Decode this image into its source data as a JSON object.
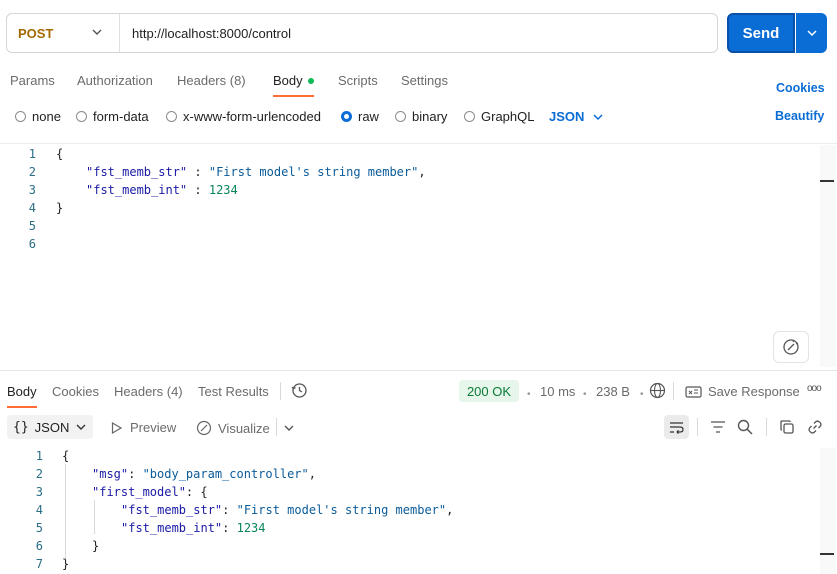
{
  "request": {
    "method": "POST",
    "url": "http://localhost:8000/control",
    "send_label": "Send"
  },
  "request_tabs": [
    {
      "label": "Params"
    },
    {
      "label": "Authorization"
    },
    {
      "label": "Headers (8)"
    },
    {
      "label": "Body",
      "active": true
    },
    {
      "label": "Scripts"
    },
    {
      "label": "Settings"
    }
  ],
  "cookies_link": "Cookies",
  "beautify_link": "Beautify",
  "body_types": [
    {
      "label": "none"
    },
    {
      "label": "form-data"
    },
    {
      "label": "x-www-form-urlencoded"
    },
    {
      "label": "raw",
      "selected": true
    },
    {
      "label": "binary"
    },
    {
      "label": "GraphQL"
    }
  ],
  "raw_format": "JSON",
  "request_body": {
    "line_numbers": [
      "1",
      "2",
      "3",
      "4",
      "5",
      "6"
    ],
    "l1_open": "{",
    "l2_key": "\"fst_memb_str\"",
    "l2_sep": " : ",
    "l2_val": "\"First model's string member\"",
    "l2_comma": ",",
    "l3_key": "\"fst_memb_int\"",
    "l3_sep": " : ",
    "l3_val": "1234",
    "l4_close": "}"
  },
  "response_tabs": [
    {
      "label": "Body",
      "active": true
    },
    {
      "label": "Cookies"
    },
    {
      "label": "Headers (4)"
    },
    {
      "label": "Test Results"
    }
  ],
  "response_meta": {
    "status": "200 OK",
    "time": "10 ms",
    "size": "238 B",
    "save_label": "Save Response",
    "more": "ooo"
  },
  "response_toolbar": {
    "format": "JSON",
    "format_prefix": "{}",
    "preview_label": "Preview",
    "visualize_label": "Visualize"
  },
  "response_body": {
    "line_numbers": [
      "1",
      "2",
      "3",
      "4",
      "5",
      "6",
      "7"
    ],
    "l1_open": "{",
    "l2_key": "\"msg\"",
    "l2_sep": ": ",
    "l2_val": "\"body_param_controller\"",
    "l2_comma": ",",
    "l3_key": "\"first_model\"",
    "l3_sep": ": ",
    "l3_open": "{",
    "l4_key": "\"fst_memb_str\"",
    "l4_sep": ": ",
    "l4_val": "\"First model's string member\"",
    "l4_comma": ",",
    "l5_key": "\"fst_memb_int\"",
    "l5_sep": ": ",
    "l5_val": "1234",
    "l6_close": "}",
    "l7_close": "}"
  },
  "colors": {
    "accent": "#0a6cd5",
    "method": "#a36a00",
    "tab_underline": "#ff6c37",
    "status_ok": "#0a7a37"
  }
}
